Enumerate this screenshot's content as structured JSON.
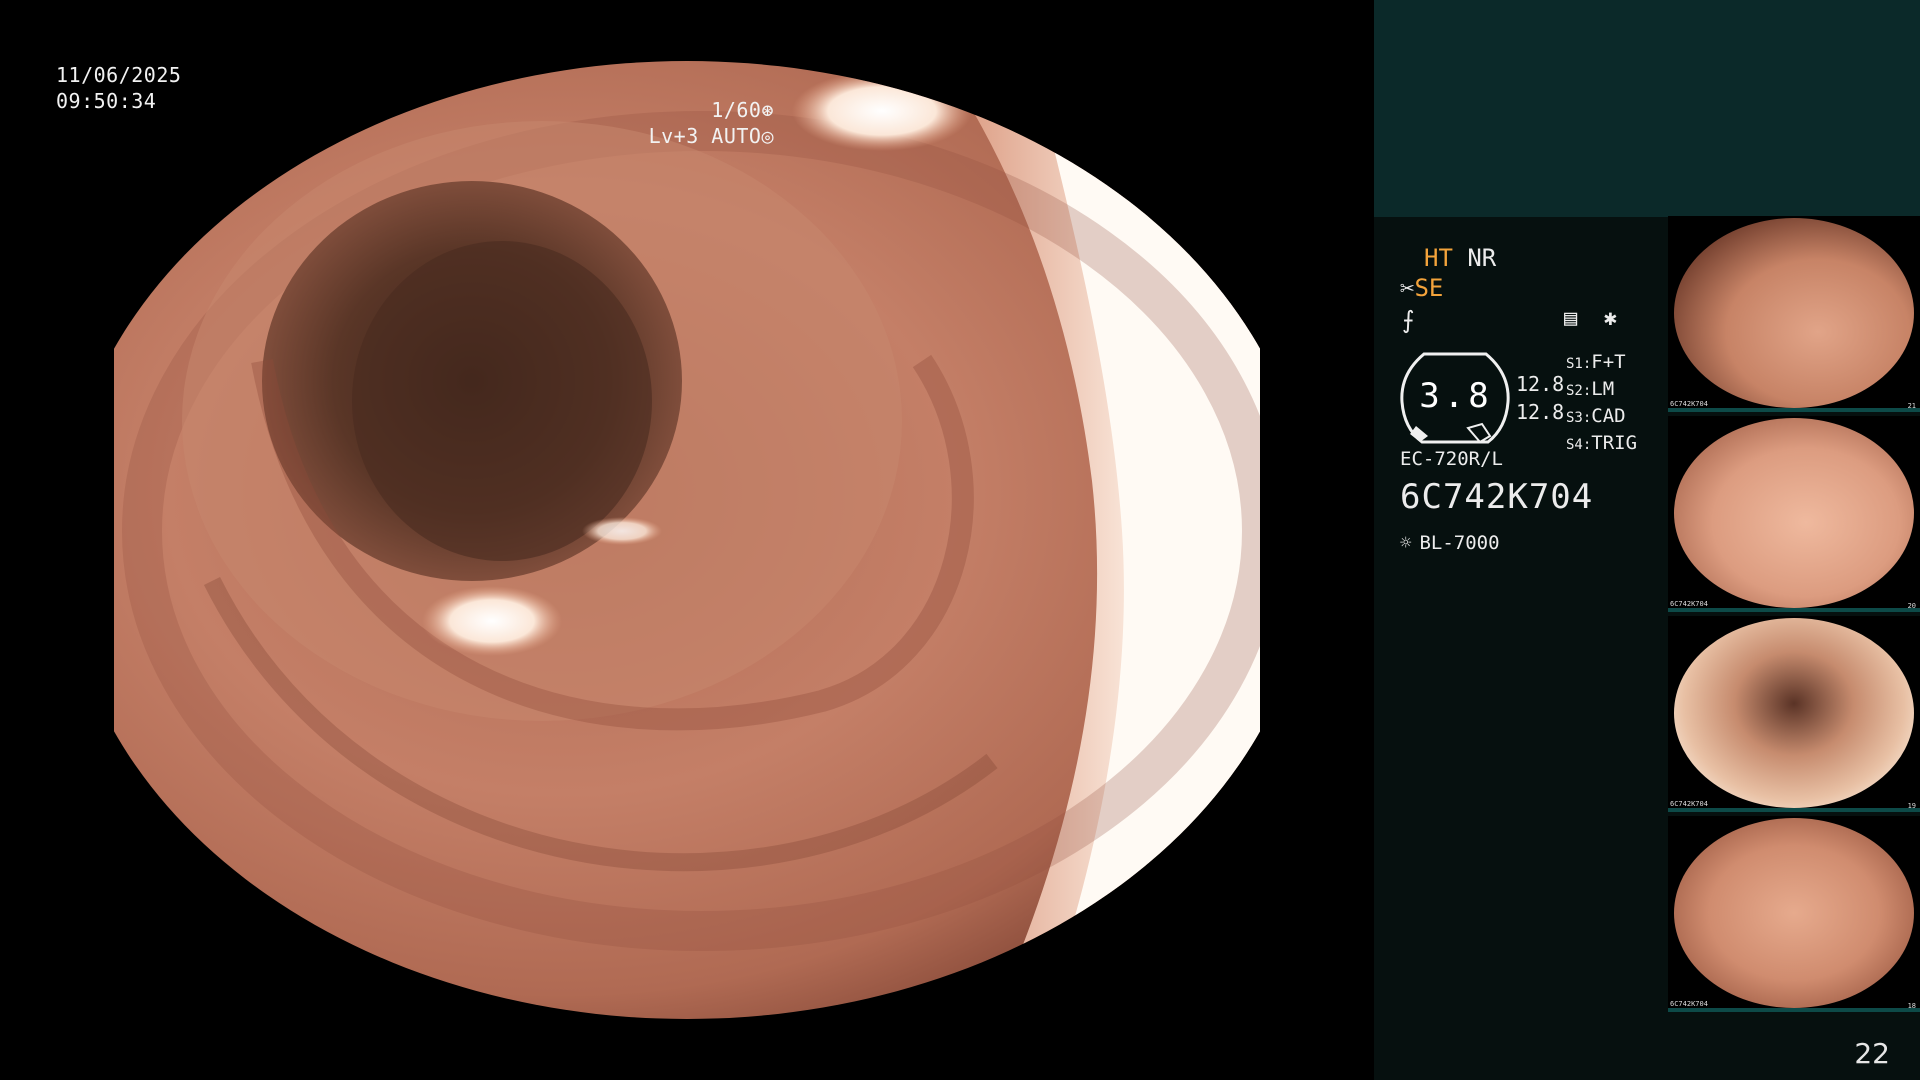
{
  "osd": {
    "date": "11/06/2025",
    "time": "09:50:34",
    "shutter": "1/60",
    "level": "Lv+3 AUTO"
  },
  "panel": {
    "mode_ht": "HT",
    "mode_nr": "NR",
    "mode_se": "SE",
    "gauge_value": "3.8",
    "gauge_num1": "12.8",
    "gauge_num2": "12.8",
    "settings": [
      {
        "key": "S1:",
        "value": "F+T"
      },
      {
        "key": "S2:",
        "value": "LM"
      },
      {
        "key": "S3:",
        "value": "CAD"
      },
      {
        "key": "S4:",
        "value": "TRIG"
      }
    ],
    "scope_model": "EC-720R/L",
    "serial": "6C742K704",
    "light_source": "BL-7000"
  },
  "thumbnails": [
    {
      "label": "6C742K704",
      "index": "21"
    },
    {
      "label": "6C742K704",
      "index": "20"
    },
    {
      "label": "6C742K704",
      "index": "19"
    },
    {
      "label": "6C742K704",
      "index": "18"
    }
  ],
  "page_number": "22",
  "colors": {
    "accent_orange": "#f3a33b",
    "panel_bg": "#06100f",
    "top_box": "#0b2929"
  },
  "icons": [
    "shutter-icon",
    "auto-iris-icon",
    "scissors-icon",
    "flash-icon",
    "menu-icon",
    "asterisk-icon",
    "light-bulb-icon"
  ]
}
